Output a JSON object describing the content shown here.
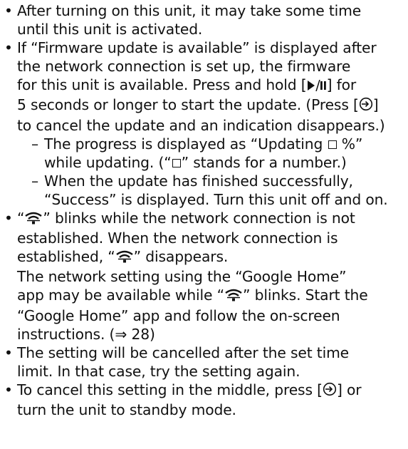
{
  "bullets": {
    "b1": {
      "line1": "After turning on this unit, it may take some time",
      "line2": "until this unit is activated."
    },
    "b2": {
      "line1": "If “Firmware update is available” is displayed after",
      "line2": "the network connection is set up, the firmware",
      "line3_pre": "for this unit is available. Press and hold [",
      "line3_post": "] for",
      "line4_pre": "5 seconds or longer to start the update. (Press [",
      "line4_post": "]",
      "line5": "to cancel the update and an indication disappears.)",
      "sub1": {
        "line1_pre": "The progress is displayed as “Updating ",
        "line1_post": " %”",
        "line2_pre": "while updating. (“",
        "line2_post": "” stands for a number.)"
      },
      "sub2": {
        "line1": "When the update has finished successfully,",
        "line2": "“Success” is displayed. Turn this unit off and on."
      }
    },
    "b3": {
      "line1_pre": "“",
      "line1_post": "” blinks while the network connection is not",
      "line2": "established. When the network connection is",
      "line3_pre": "established, “",
      "line3_post": "” disappears.",
      "line4": "The network setting using the “Google Home”",
      "line5_pre": "app may be available while “",
      "line5_post": "” blinks. Start the",
      "line6": "“Google Home” app and follow the on-screen",
      "line7": "instructions. (⇒ 28)"
    },
    "b4": {
      "line1": "The setting will be cancelled after the set time",
      "line2": "limit. In that case, try the setting again."
    },
    "b5": {
      "line1_pre": "To cancel this setting in the middle, press [",
      "line1_post": "] or",
      "line2": "turn the unit to standby mode."
    }
  },
  "symbols": {
    "bullet": "•",
    "dash": "–"
  },
  "icons": {
    "play_pause": "play-pause-icon",
    "power": "power-input-icon",
    "wifi": "wifi-icon",
    "box": "box-placeholder"
  }
}
